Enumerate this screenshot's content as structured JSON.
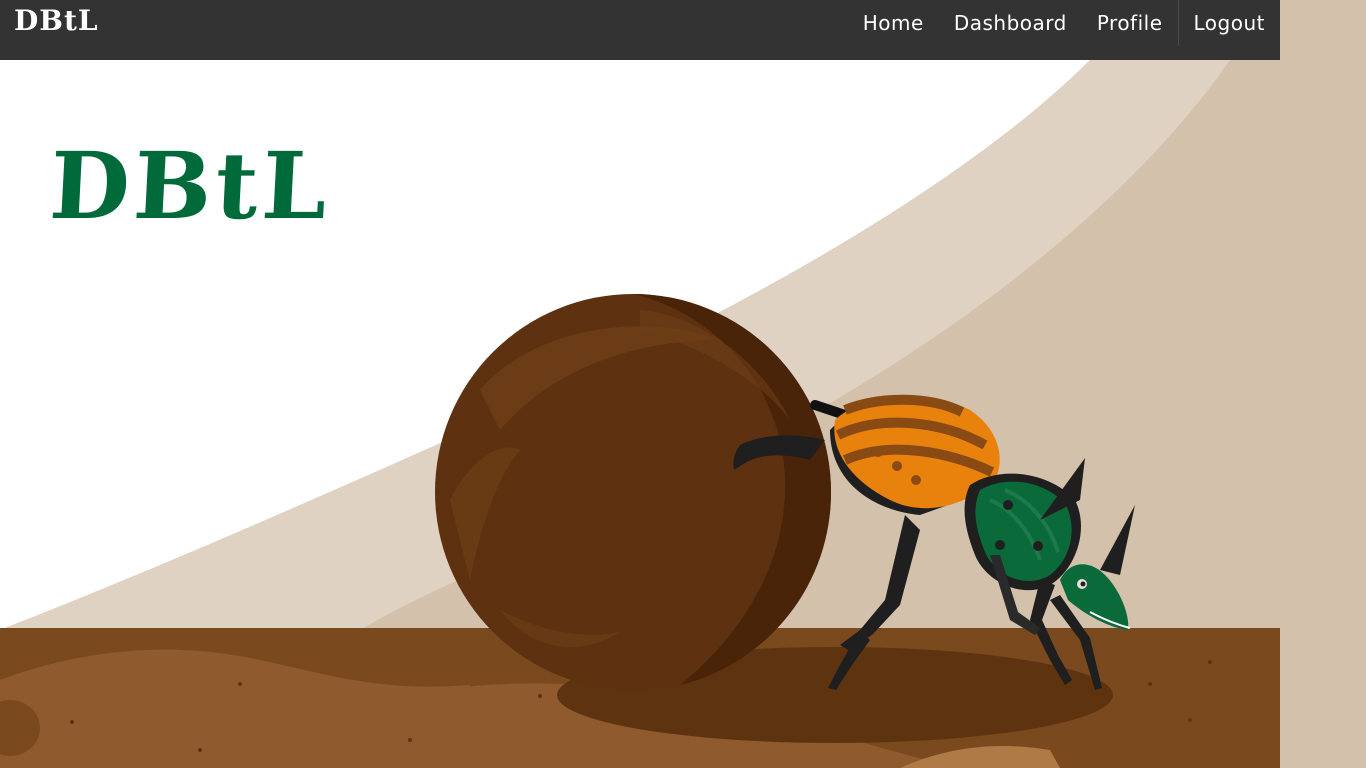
{
  "navbar": {
    "brand": "DBtL",
    "links": [
      {
        "label": "Home"
      },
      {
        "label": "Dashboard"
      },
      {
        "label": "Profile"
      },
      {
        "label": "Logout"
      }
    ]
  },
  "hero": {
    "logo_text": "DBtL",
    "illustration": "dung-beetle-rolling-ball",
    "colors": {
      "brand_green": "#006a3a",
      "navbar": "#333333",
      "sky": "#ffffff",
      "hill_light": "#e0d2c2",
      "hill_dark": "#d3c1ab",
      "ground": "#7a4a1e",
      "ball": "#5e3210",
      "shell_orange": "#e8820c"
    }
  }
}
